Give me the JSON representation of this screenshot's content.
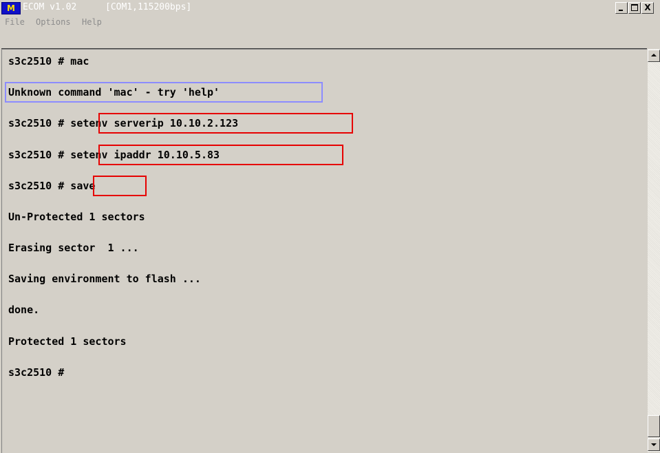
{
  "window": {
    "app_icon_glyph": "M",
    "title_app": "ECOM v1.02",
    "title_port": "[COM1,115200bps]",
    "controls": {
      "minimize": "_",
      "maximize": "□",
      "close": "X"
    }
  },
  "menu": [
    {
      "label": "File"
    },
    {
      "label": "Options"
    },
    {
      "label": "Help"
    }
  ],
  "terminal": {
    "lines": [
      "s3c2510 # mac",
      "Unknown command 'mac' - try 'help'",
      "s3c2510 # setenv serverip 10.10.2.123",
      "s3c2510 # setenv ipaddr 10.10.5.83",
      "s3c2510 # save",
      "Un-Protected 1 sectors",
      "Erasing sector  1 ...",
      "Saving environment to flash ...",
      "done.",
      "Protected 1 sectors",
      "s3c2510 #"
    ]
  },
  "colors": {
    "highlight_red": "#e60000",
    "highlight_blue": "#8c8cff",
    "terminal_bg": "#d4d0c8"
  }
}
